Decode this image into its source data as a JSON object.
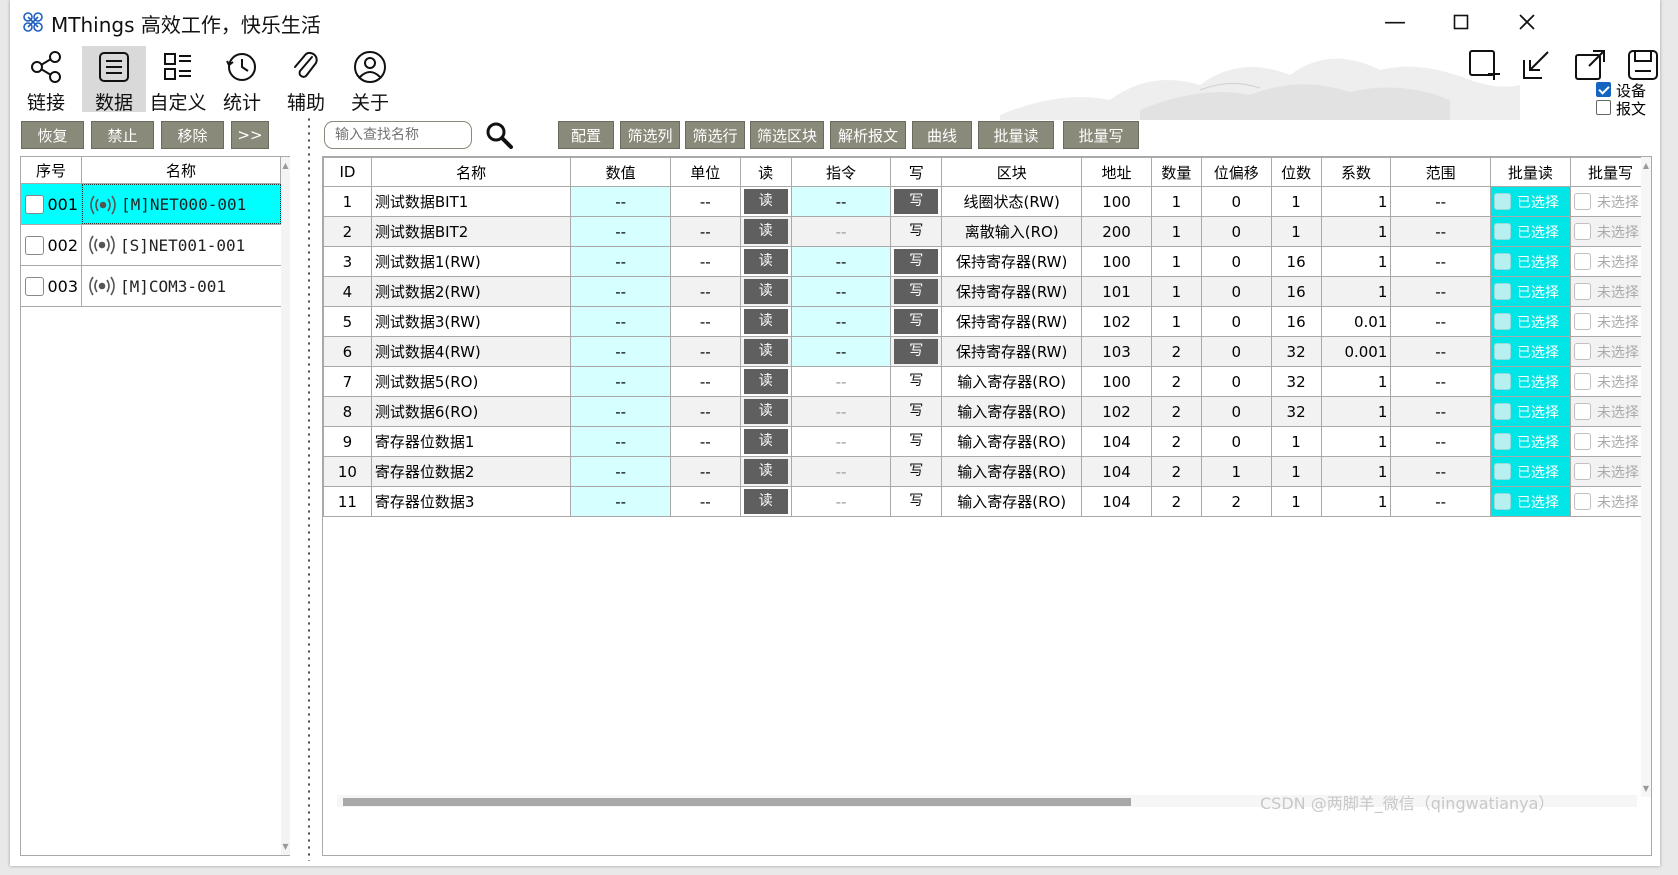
{
  "titlebar": {
    "title": "MThings  高效工作，快乐生活",
    "minimize_glyph": "—",
    "maximize_glyph": "☐",
    "close_glyph": "✕"
  },
  "toolbar": [
    {
      "label": "链接",
      "icon": "share-icon",
      "active": false
    },
    {
      "label": "数据",
      "icon": "list-icon",
      "active": true
    },
    {
      "label": "自定义",
      "icon": "layout-icon",
      "active": false
    },
    {
      "label": "统计",
      "icon": "clock-icon",
      "active": false
    },
    {
      "label": "辅助",
      "icon": "paperclip-icon",
      "active": false
    },
    {
      "label": "关于",
      "icon": "user-icon",
      "active": false
    }
  ],
  "right_tools": [
    "add-window-icon",
    "shrink-icon",
    "expand-icon",
    "save-icon"
  ],
  "options": {
    "device_label": "设备",
    "device_checked": true,
    "message_label": "报文",
    "message_checked": false
  },
  "left_panel": {
    "buttons": [
      "恢复",
      "禁止",
      "移除",
      ">>"
    ],
    "headers": [
      "序号",
      "名称"
    ],
    "devices": [
      {
        "num": "001",
        "name": "[M]NET000-001",
        "selected": true
      },
      {
        "num": "002",
        "name": "[S]NET001-001",
        "selected": false
      },
      {
        "num": "003",
        "name": "[M]COM3-001",
        "selected": false
      }
    ]
  },
  "right_toolbar": {
    "search_placeholder": "输入查找名称",
    "buttons": [
      "配置",
      "筛选列",
      "筛选行",
      "筛选区块",
      "解析报文",
      "曲线",
      "批量读",
      "批量写"
    ]
  },
  "table": {
    "headers": [
      "ID",
      "名称",
      "数值",
      "单位",
      "读",
      "指令",
      "写",
      "区块",
      "地址",
      "数量",
      "位偏移",
      "位数",
      "系数",
      "范围",
      "批量读",
      "批量写"
    ],
    "read_label": "读",
    "write_label": "写",
    "batch_read_label": "已选择",
    "batch_write_label": "未选择",
    "rows": [
      {
        "id": "1",
        "name": "测试数据BIT1",
        "value": "--",
        "unit": "--",
        "cmd": "--",
        "block": "线圈状态(RW)",
        "addr": "100",
        "qty": "1",
        "offset": "0",
        "bits": "1",
        "coef": "1",
        "range": "--",
        "writable": true
      },
      {
        "id": "2",
        "name": "测试数据BIT2",
        "value": "--",
        "unit": "--",
        "cmd": "--",
        "block": "离散输入(RO)",
        "addr": "200",
        "qty": "1",
        "offset": "0",
        "bits": "1",
        "coef": "1",
        "range": "--",
        "writable": false
      },
      {
        "id": "3",
        "name": "测试数据1(RW)",
        "value": "--",
        "unit": "--",
        "cmd": "--",
        "block": "保持寄存器(RW)",
        "addr": "100",
        "qty": "1",
        "offset": "0",
        "bits": "16",
        "coef": "1",
        "range": "--",
        "writable": true
      },
      {
        "id": "4",
        "name": "测试数据2(RW)",
        "value": "--",
        "unit": "--",
        "cmd": "--",
        "block": "保持寄存器(RW)",
        "addr": "101",
        "qty": "1",
        "offset": "0",
        "bits": "16",
        "coef": "1",
        "range": "--",
        "writable": true
      },
      {
        "id": "5",
        "name": "测试数据3(RW)",
        "value": "--",
        "unit": "--",
        "cmd": "--",
        "block": "保持寄存器(RW)",
        "addr": "102",
        "qty": "1",
        "offset": "0",
        "bits": "16",
        "coef": "0.01",
        "range": "--",
        "writable": true
      },
      {
        "id": "6",
        "name": "测试数据4(RW)",
        "value": "--",
        "unit": "--",
        "cmd": "--",
        "block": "保持寄存器(RW)",
        "addr": "103",
        "qty": "2",
        "offset": "0",
        "bits": "32",
        "coef": "0.001",
        "range": "--",
        "writable": true
      },
      {
        "id": "7",
        "name": "测试数据5(RO)",
        "value": "--",
        "unit": "--",
        "cmd": "--",
        "block": "输入寄存器(RO)",
        "addr": "100",
        "qty": "2",
        "offset": "0",
        "bits": "32",
        "coef": "1",
        "range": "--",
        "writable": false
      },
      {
        "id": "8",
        "name": "测试数据6(RO)",
        "value": "--",
        "unit": "--",
        "cmd": "--",
        "block": "输入寄存器(RO)",
        "addr": "102",
        "qty": "2",
        "offset": "0",
        "bits": "32",
        "coef": "1",
        "range": "--",
        "writable": false
      },
      {
        "id": "9",
        "name": "寄存器位数据1",
        "value": "--",
        "unit": "--",
        "cmd": "--",
        "block": "输入寄存器(RO)",
        "addr": "104",
        "qty": "2",
        "offset": "0",
        "bits": "1",
        "coef": "1",
        "range": "--",
        "writable": false
      },
      {
        "id": "10",
        "name": "寄存器位数据2",
        "value": "--",
        "unit": "--",
        "cmd": "--",
        "block": "输入寄存器(RO)",
        "addr": "104",
        "qty": "2",
        "offset": "1",
        "bits": "1",
        "coef": "1",
        "range": "--",
        "writable": false
      },
      {
        "id": "11",
        "name": "寄存器位数据3",
        "value": "--",
        "unit": "--",
        "cmd": "--",
        "block": "输入寄存器(RO)",
        "addr": "104",
        "qty": "2",
        "offset": "2",
        "bits": "1",
        "coef": "1",
        "range": "--",
        "writable": false
      }
    ]
  },
  "watermark": "CSDN @两脚羊_微信（qingwatianya）",
  "colors": {
    "button_bg": "#8a8a7a",
    "selected_row": "#00ffff",
    "cyan_cell": "#d6ffff",
    "batch_read_bg": "#00e6e6",
    "read_write_btn": "#5f5f5f",
    "check_blue": "#1565c0"
  }
}
